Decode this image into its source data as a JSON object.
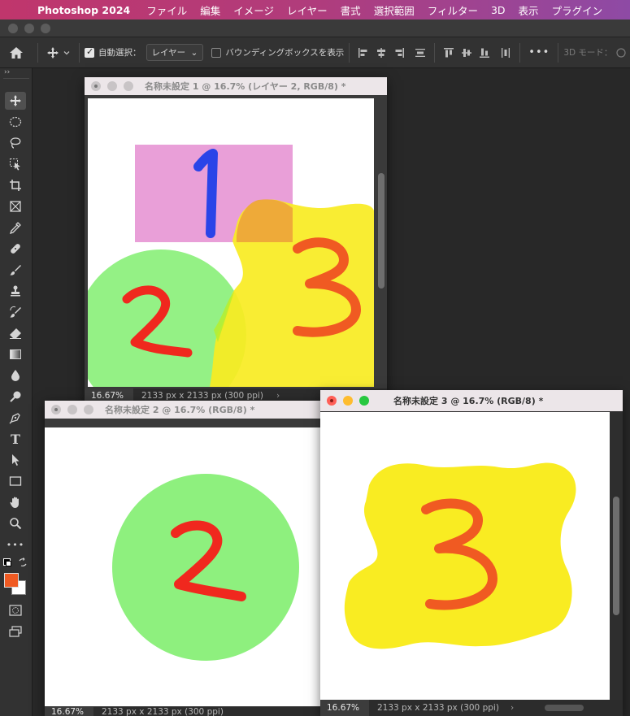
{
  "menubar": {
    "app_name": "Photoshop 2024",
    "items": [
      "ファイル",
      "編集",
      "イメージ",
      "レイヤー",
      "書式",
      "選択範囲",
      "フィルター",
      "3D",
      "表示",
      "プラグイン"
    ]
  },
  "options": {
    "auto_select_label": "自動選択：",
    "auto_select_checked": true,
    "auto_select_target": "レイヤー",
    "bounding_box_label": "バウンディングボックスを表示",
    "more_label": "•••",
    "mode_3d_label": "3D モード："
  },
  "documents": [
    {
      "title": "名称未設定 1 @ 16.7% (レイヤー 2, RGB/8) *",
      "zoom": "16.67%",
      "info": "2133 px x 2133 px (300 ppi)",
      "active": false,
      "labels": [
        "1",
        "2",
        "3"
      ]
    },
    {
      "title": "名称未設定 2 @ 16.7% (RGB/8) *",
      "zoom": "16.67%",
      "info": "2133 px x 2133 px (300 ppi)",
      "active": false,
      "labels": [
        "2"
      ]
    },
    {
      "title": "名称未設定 3 @ 16.7% (RGB/8) *",
      "zoom": "16.67%",
      "info": "2133 px x 2133 px (300 ppi)",
      "active": true,
      "labels": [
        "3"
      ]
    }
  ],
  "colors": {
    "foreground": "#f05a22",
    "background": "#ffffff",
    "pink": "#e99fd8",
    "green": "#8ef07e",
    "yellow": "#f9ec22",
    "blue": "#2a44e8",
    "red": "#f0281e",
    "orange": "#f05a22"
  }
}
